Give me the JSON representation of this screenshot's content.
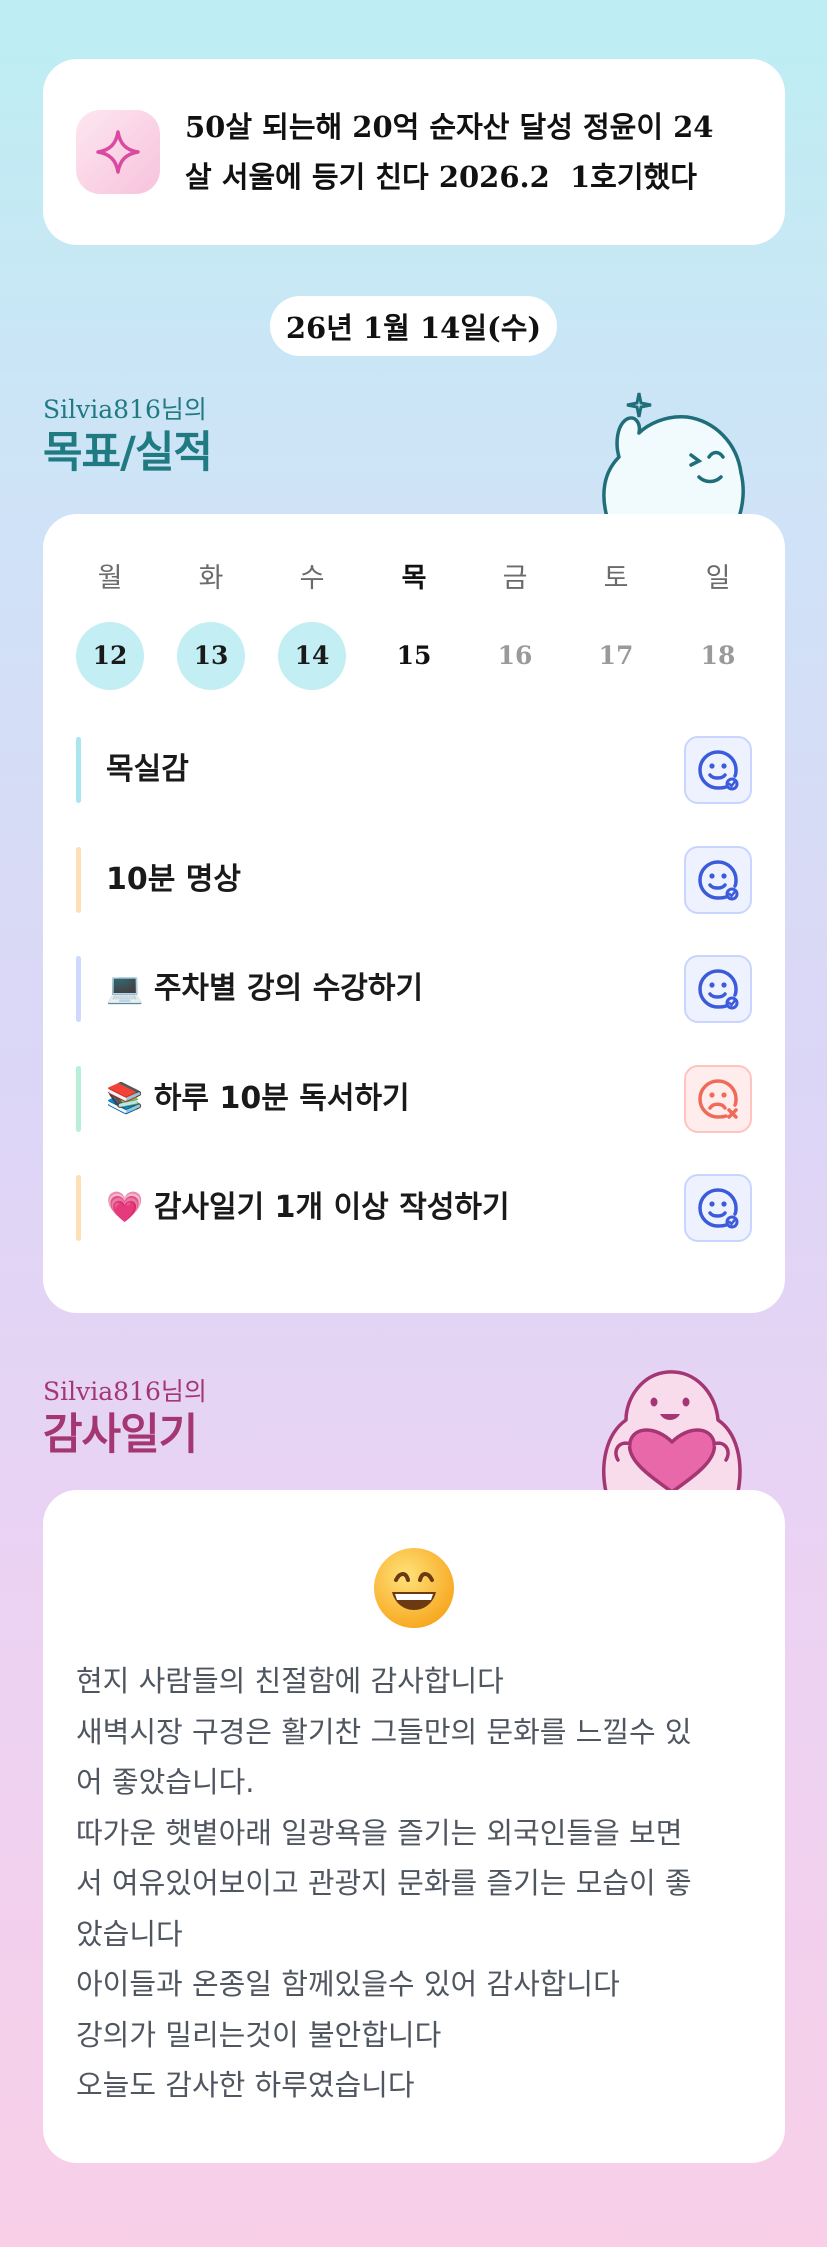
{
  "goal": {
    "line1": "50살 되는해 20억 순자산 달성 정윤이 24",
    "line2": "살 서울에 등기 친다 2026.2  1호기했다",
    "icon": "sparkle-icon"
  },
  "date": "26년 1월 14일(수)",
  "tracker": {
    "user": "Silvia816님의",
    "title": "목표/실적",
    "weekdays": [
      "월",
      "화",
      "수",
      "목",
      "금",
      "토",
      "일"
    ],
    "days": [
      "12",
      "13",
      "14",
      "15",
      "16",
      "17",
      "18"
    ],
    "completed_days": [
      "12",
      "13",
      "14"
    ],
    "today": "15",
    "habits": [
      {
        "label": "목실감",
        "emoji": "",
        "status": "success",
        "bar_color": "#a9e6ee"
      },
      {
        "label": "10분 명상",
        "emoji": "",
        "status": "success",
        "bar_color": "#fde0b5"
      },
      {
        "label": "주차별 강의 수강하기",
        "emoji": "💻",
        "status": "success",
        "bar_color": "#cfd9ff"
      },
      {
        "label": "하루 10분 독서하기",
        "emoji": "📚",
        "status": "fail",
        "bar_color": "#b9efd8"
      },
      {
        "label": "감사일기 1개 이상 작성하기",
        "emoji": "💗",
        "status": "success",
        "bar_color": "#fde0b5"
      }
    ]
  },
  "gratitude": {
    "user": "Silvia816님의",
    "title": "감사일기",
    "emoji": "😄",
    "lines": [
      "현지 사람들의 친절함에 감사합니다",
      "새벽시장 구경은 활기찬 그들만의 문화를 느낄수 있",
      "어 좋았습니다.",
      "따가운 햇볕아래 일광욕을 즐기는 외국인들을 보면",
      "서 여유있어보이고 관광지 문화를 즐기는 모습이 좋",
      "았습니다",
      "아이들과 온종일 함께있을수 있어 감사합니다",
      "강의가 밀리는것이 불안합니다",
      "오늘도 감사한 하루였습니다"
    ]
  },
  "colors": {
    "teal": "#1f7a82",
    "plum": "#a43673",
    "success": "#3b5bdb",
    "fail": "#f06a5a"
  }
}
